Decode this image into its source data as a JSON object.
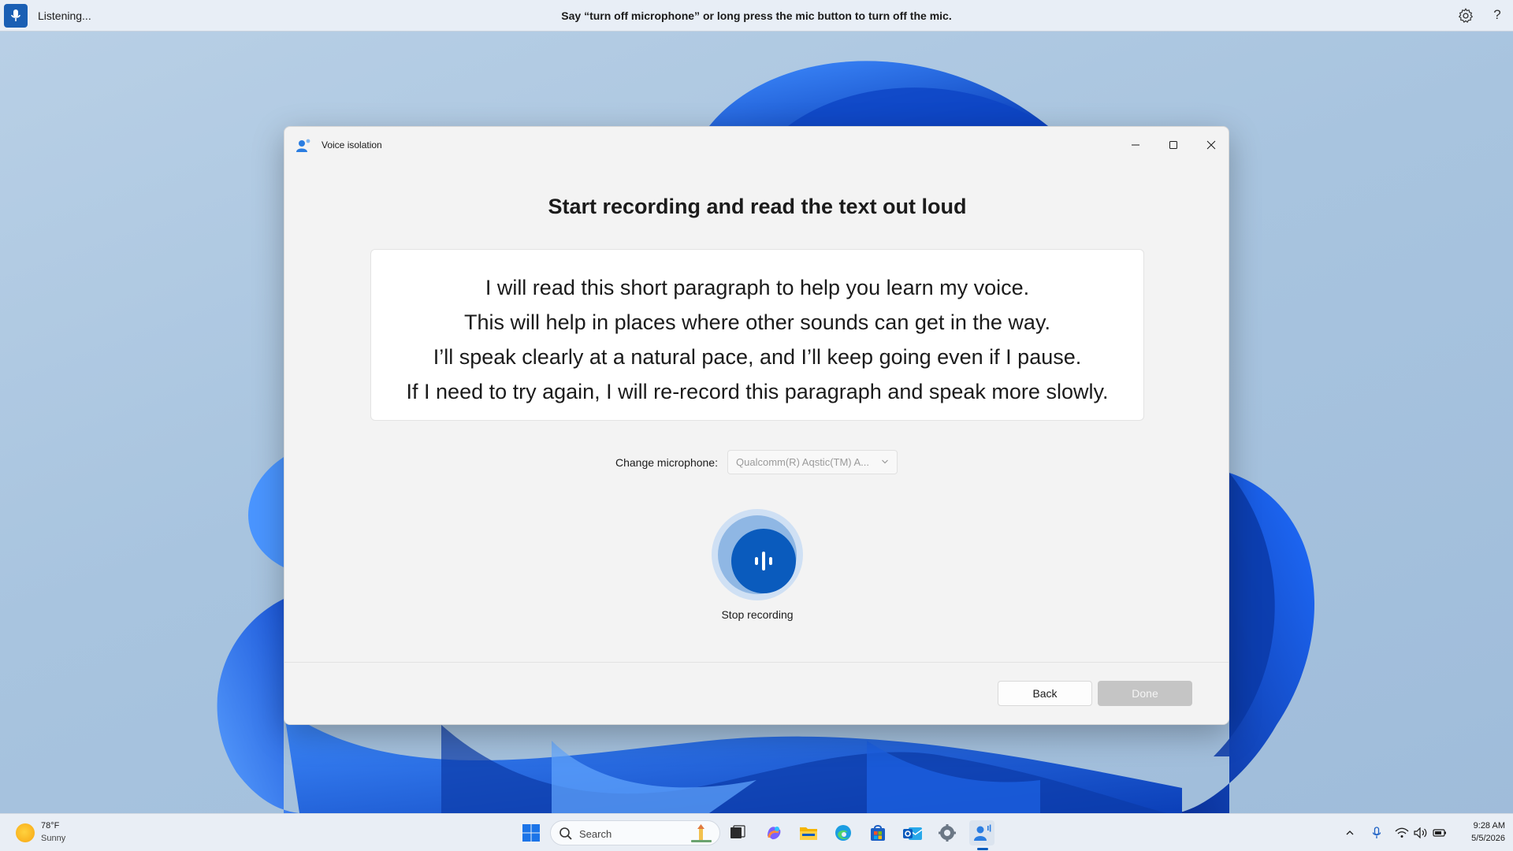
{
  "voice_bar": {
    "status": "Listening...",
    "hint": "Say “turn off microphone” or long press the mic button to turn off the mic.",
    "mic_icon": "microphone-icon",
    "settings_icon": "gear-icon",
    "help_label": "?"
  },
  "window": {
    "title": "Voice isolation",
    "icon": "voice-isolation-icon",
    "controls": [
      "minimize",
      "maximize",
      "close"
    ]
  },
  "main": {
    "heading": "Start recording and read the text out loud",
    "paragraph_lines": [
      "I will read this short paragraph to help you learn my voice.",
      "This will help in places where other sounds can get in the way.",
      "I’ll speak clearly at a natural pace, and I’ll keep going even if I pause.",
      "If I need to try again, I will re-record this paragraph and speak more slowly."
    ],
    "microphone": {
      "label": "Change microphone:",
      "selected": "Qualcomm(R) Aqstic(TM) A..."
    },
    "record_button_label": "Stop recording"
  },
  "footer": {
    "back_label": "Back",
    "done_label": "Done"
  },
  "taskbar": {
    "weather": {
      "temp": "78°F",
      "condition": "Sunny"
    },
    "search_placeholder": "Search",
    "apps": [
      "start",
      "search",
      "task-view",
      "copilot",
      "file-explorer",
      "edge",
      "store",
      "outlook",
      "settings",
      "voice-access"
    ],
    "tray_icons": [
      "chevron-up",
      "microphone",
      "wifi",
      "volume",
      "battery"
    ],
    "time": "9:28 AM",
    "date": "5/5/2026"
  },
  "colors": {
    "accent": "#0a5bbd",
    "wallpaper_blue": "#1a6cf0"
  }
}
